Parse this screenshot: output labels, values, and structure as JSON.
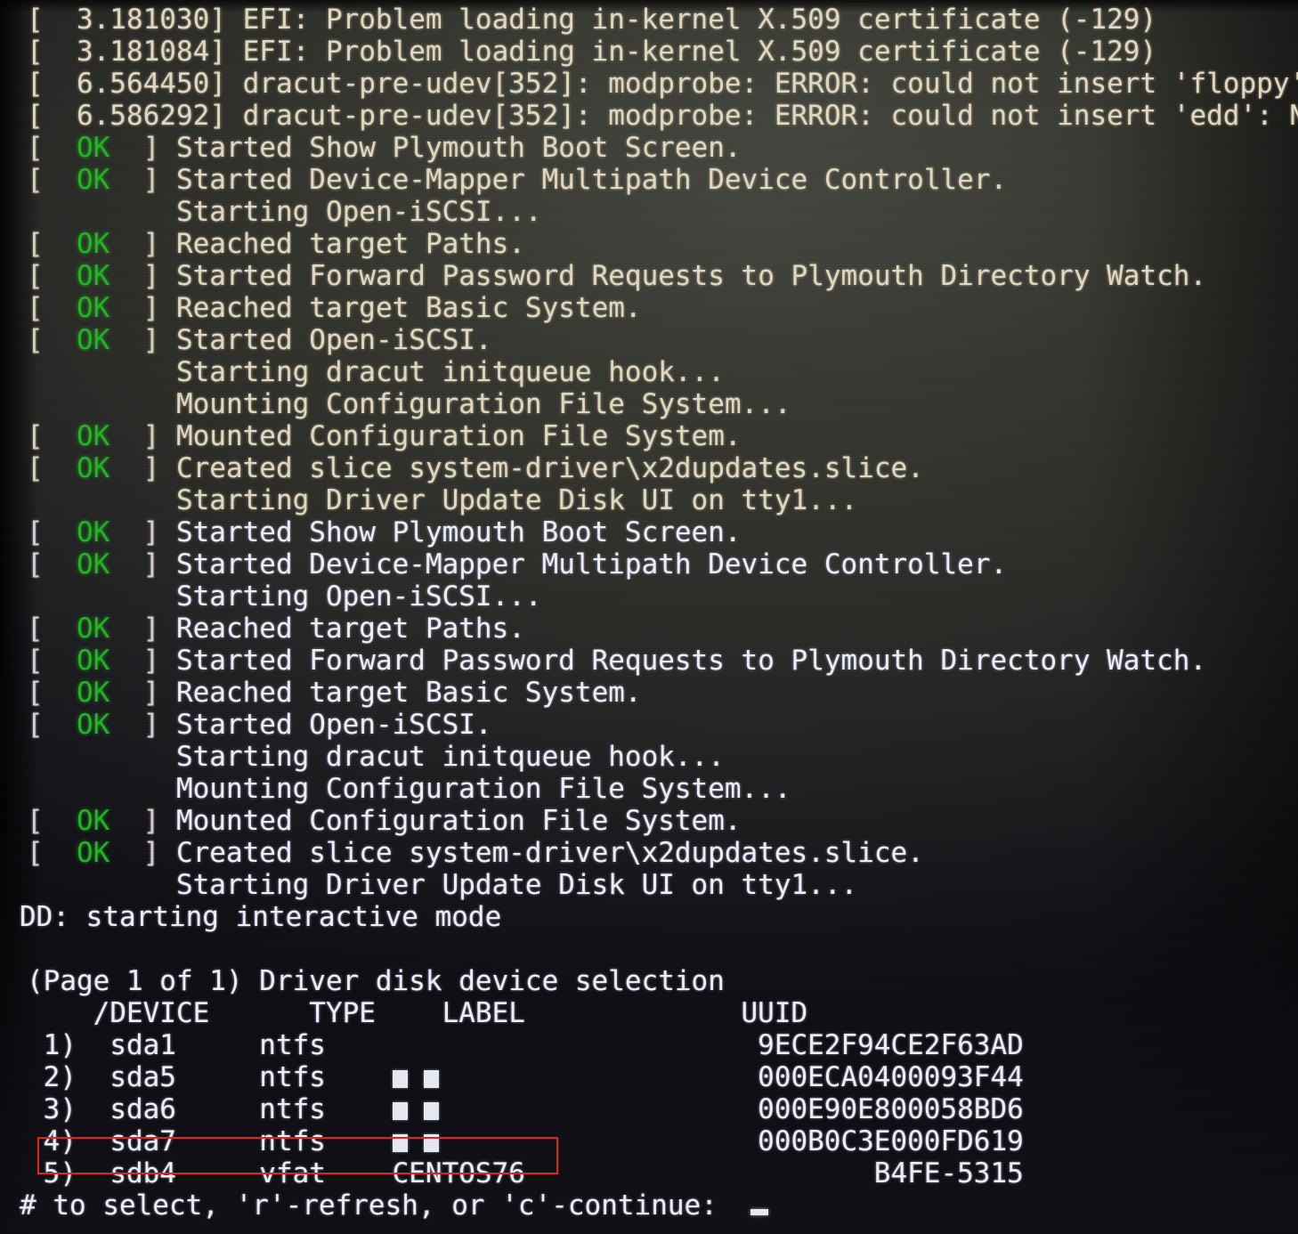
{
  "screen": {
    "kind": "linux-boot-console",
    "background_color": "#2c2e29",
    "text_color": "#ddd6c4",
    "ok_color": "#22b422",
    "highlight_color": "#e8201b"
  },
  "kernel_messages": [
    {
      "timestamp": "3.181030",
      "text": "EFI: Problem loading in-kernel X.509 certificate (-129)"
    },
    {
      "timestamp": "3.181084",
      "text": "EFI: Problem loading in-kernel X.509 certificate (-129)"
    },
    {
      "timestamp": "6.564450",
      "text": "dracut-pre-udev[352]: modprobe: ERROR: could not insert 'floppy':"
    },
    {
      "timestamp": "6.586292",
      "text": "dracut-pre-udev[352]: modprobe: ERROR: could not insert 'edd': No"
    }
  ],
  "systemd_lines": [
    {
      "status": "OK",
      "text": "Started Show Plymouth Boot Screen."
    },
    {
      "status": "OK",
      "text": "Started Device-Mapper Multipath Device Controller."
    },
    {
      "status": "",
      "text": "Starting Open-iSCSI..."
    },
    {
      "status": "OK",
      "text": "Reached target Paths."
    },
    {
      "status": "OK",
      "text": "Started Forward Password Requests to Plymouth Directory Watch."
    },
    {
      "status": "OK",
      "text": "Reached target Basic System."
    },
    {
      "status": "OK",
      "text": "Started Open-iSCSI."
    },
    {
      "status": "",
      "text": "Starting dracut initqueue hook..."
    },
    {
      "status": "",
      "text": "Mounting Configuration File System..."
    },
    {
      "status": "OK",
      "text": "Mounted Configuration File System."
    },
    {
      "status": "OK",
      "text": "Created slice system-driver\\x2dupdates.slice."
    },
    {
      "status": "",
      "text": "Starting Driver Update Disk UI on tty1..."
    },
    {
      "status": "OK",
      "text": "Started Show Plymouth Boot Screen."
    },
    {
      "status": "OK",
      "text": "Started Device-Mapper Multipath Device Controller."
    },
    {
      "status": "",
      "text": "Starting Open-iSCSI..."
    },
    {
      "status": "OK",
      "text": "Reached target Paths."
    },
    {
      "status": "OK",
      "text": "Started Forward Password Requests to Plymouth Directory Watch."
    },
    {
      "status": "OK",
      "text": "Reached target Basic System."
    },
    {
      "status": "OK",
      "text": "Started Open-iSCSI."
    },
    {
      "status": "",
      "text": "Starting dracut initqueue hook..."
    },
    {
      "status": "",
      "text": "Mounting Configuration File System..."
    },
    {
      "status": "OK",
      "text": "Mounted Configuration File System."
    },
    {
      "status": "OK",
      "text": "Created slice system-driver\\x2dupdates.slice."
    },
    {
      "status": "",
      "text": "Starting Driver Update Disk UI on tty1..."
    }
  ],
  "dd_notice": "DD: starting interactive mode",
  "selection": {
    "page_header": "(Page 1 of 1) Driver disk device selection",
    "columns": [
      "/DEVICE",
      "TYPE",
      "LABEL",
      "UUID"
    ],
    "rows": [
      {
        "index": "1)",
        "device": "sda1",
        "type": "ntfs",
        "label": "",
        "label_blocks": 0,
        "uuid": "9ECE2F94CE2F63AD"
      },
      {
        "index": "2)",
        "device": "sda5",
        "type": "ntfs",
        "label": "",
        "label_blocks": 2,
        "uuid": "000ECA0400093F44"
      },
      {
        "index": "3)",
        "device": "sda6",
        "type": "ntfs",
        "label": "",
        "label_blocks": 2,
        "uuid": "000E90E800058BD6"
      },
      {
        "index": "4)",
        "device": "sda7",
        "type": "ntfs",
        "label": "",
        "label_blocks": 2,
        "uuid": "000B0C3E000FD619"
      },
      {
        "index": "5)",
        "device": "sdb4",
        "type": "vfat",
        "label": "CENTOS76",
        "label_blocks": 0,
        "uuid": "B4FE-5315"
      }
    ],
    "highlighted_row_index": 4,
    "prompt": "# to select, 'r'-refresh, or 'c'-continue:"
  }
}
